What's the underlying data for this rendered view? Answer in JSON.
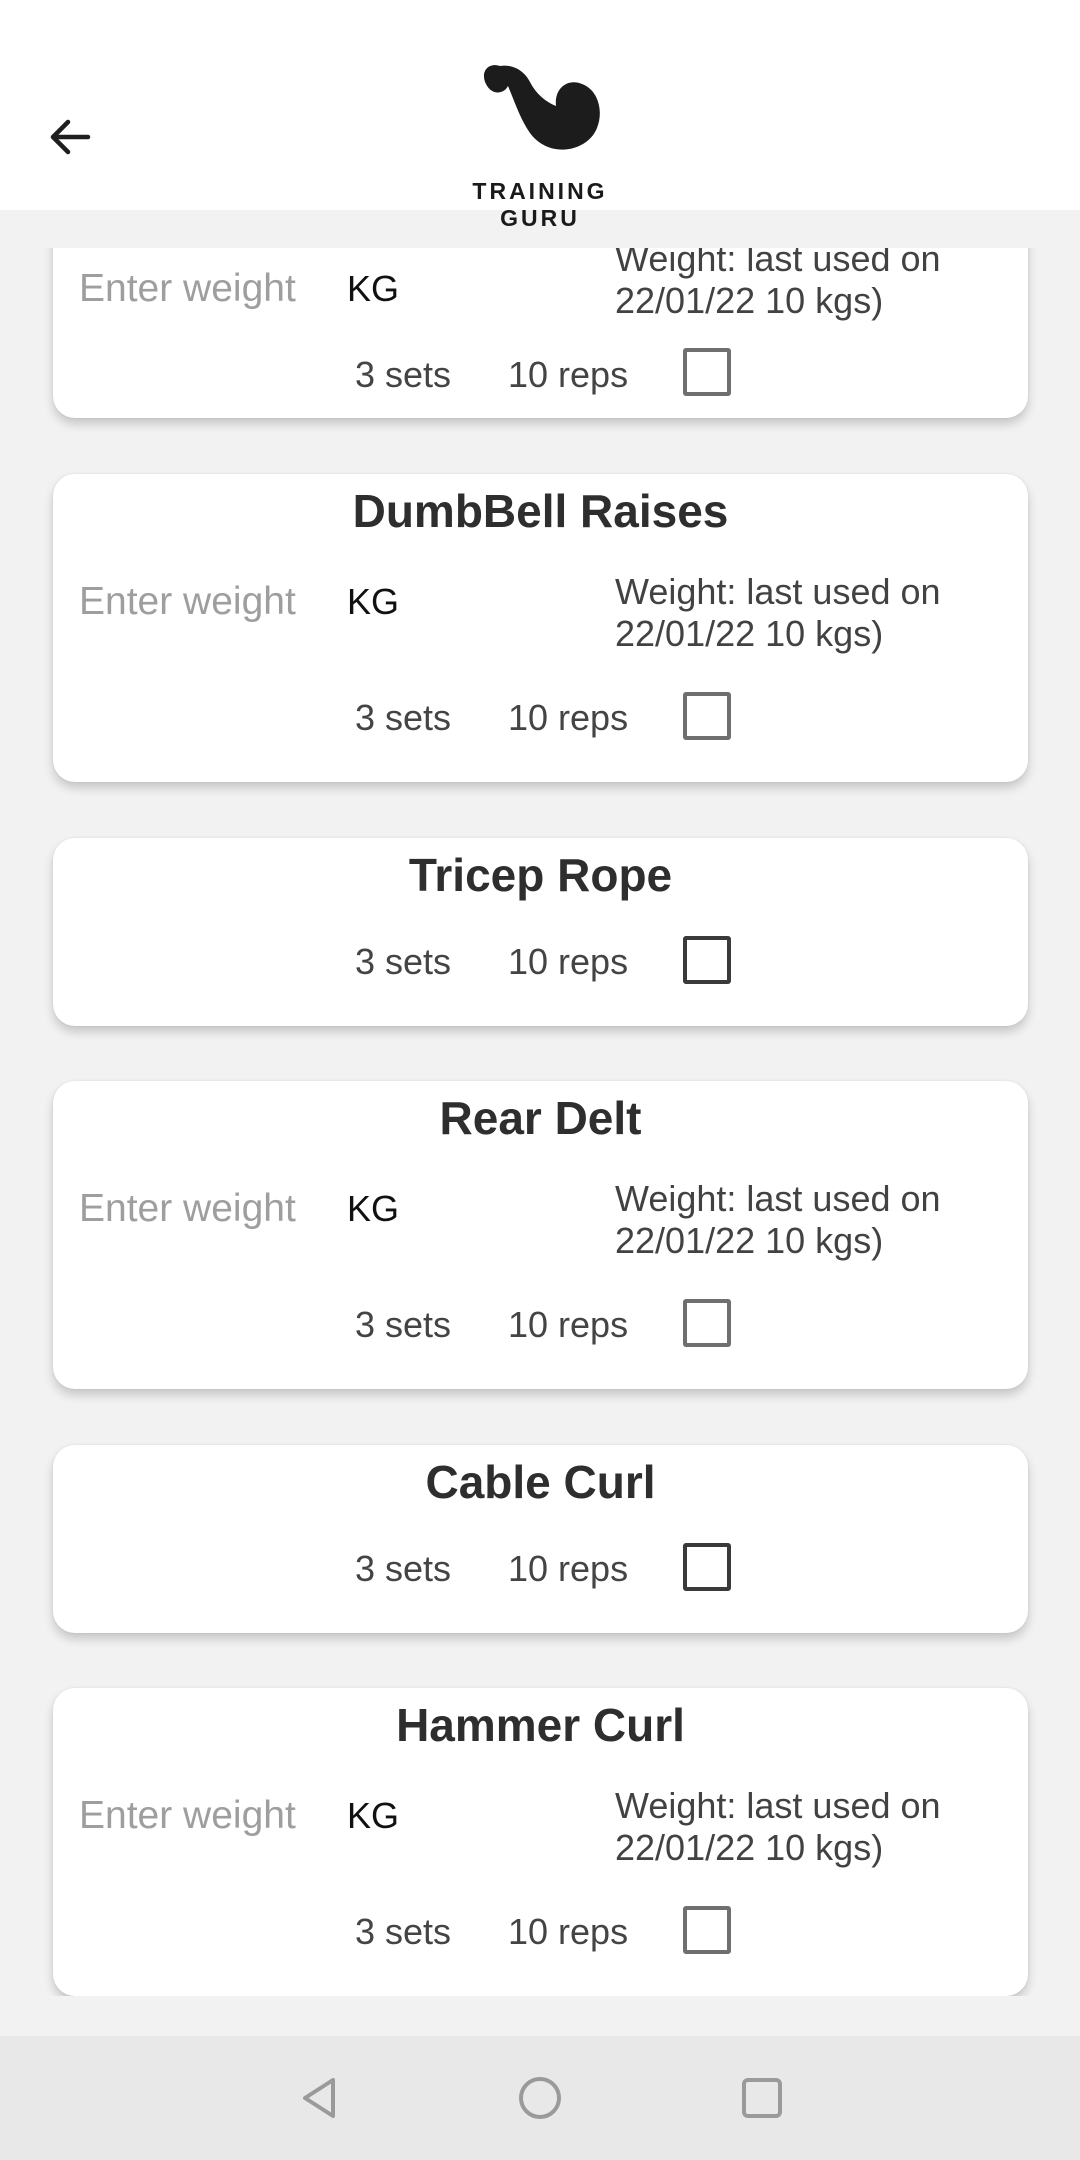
{
  "header": {
    "logo_text": "TRAINING GURU"
  },
  "icons": {
    "back": "arrow-left-icon",
    "logo": "flexed-arm-logo",
    "nav_back": "triangle-back-icon",
    "nav_home": "circle-home-icon",
    "nav_recents": "square-recents-icon"
  },
  "colors": {
    "background": "#f2f2f2",
    "card": "#ffffff",
    "text": "#333333",
    "placeholder": "#9e9e9e"
  },
  "exercises": [
    {
      "name": "",
      "has_weight": true,
      "weight_placeholder": "Enter weight",
      "unit": "KG",
      "last_used": "Weight: last used on 22/01/22  10 kgs)",
      "last_used_line1": "Weight: last used on",
      "last_used_line2": "22/01/22  10 kgs)",
      "sets": "3 sets",
      "reps": "10 reps",
      "checked": false
    },
    {
      "name": "DumbBell Raises",
      "has_weight": true,
      "weight_placeholder": "Enter weight",
      "unit": "KG",
      "last_used_line1": "Weight: last used on",
      "last_used_line2": "22/01/22  10 kgs)",
      "sets": "3 sets",
      "reps": "10 reps",
      "checked": false
    },
    {
      "name": "Tricep Rope",
      "has_weight": false,
      "sets": "3 sets",
      "reps": "10 reps",
      "checked": false
    },
    {
      "name": "Rear Delt",
      "has_weight": true,
      "weight_placeholder": "Enter weight",
      "unit": "KG",
      "last_used_line1": "Weight: last used on",
      "last_used_line2": "22/01/22  10 kgs)",
      "sets": "3 sets",
      "reps": "10 reps",
      "checked": false
    },
    {
      "name": "Cable Curl",
      "has_weight": false,
      "sets": "3 sets",
      "reps": "10 reps",
      "checked": false
    },
    {
      "name": "Hammer Curl",
      "has_weight": true,
      "weight_placeholder": "Enter weight",
      "unit": "KG",
      "last_used_line1": "Weight: last used on",
      "last_used_line2": "22/01/22  10 kgs)",
      "sets": "3 sets",
      "reps": "10 reps",
      "checked": false
    }
  ]
}
